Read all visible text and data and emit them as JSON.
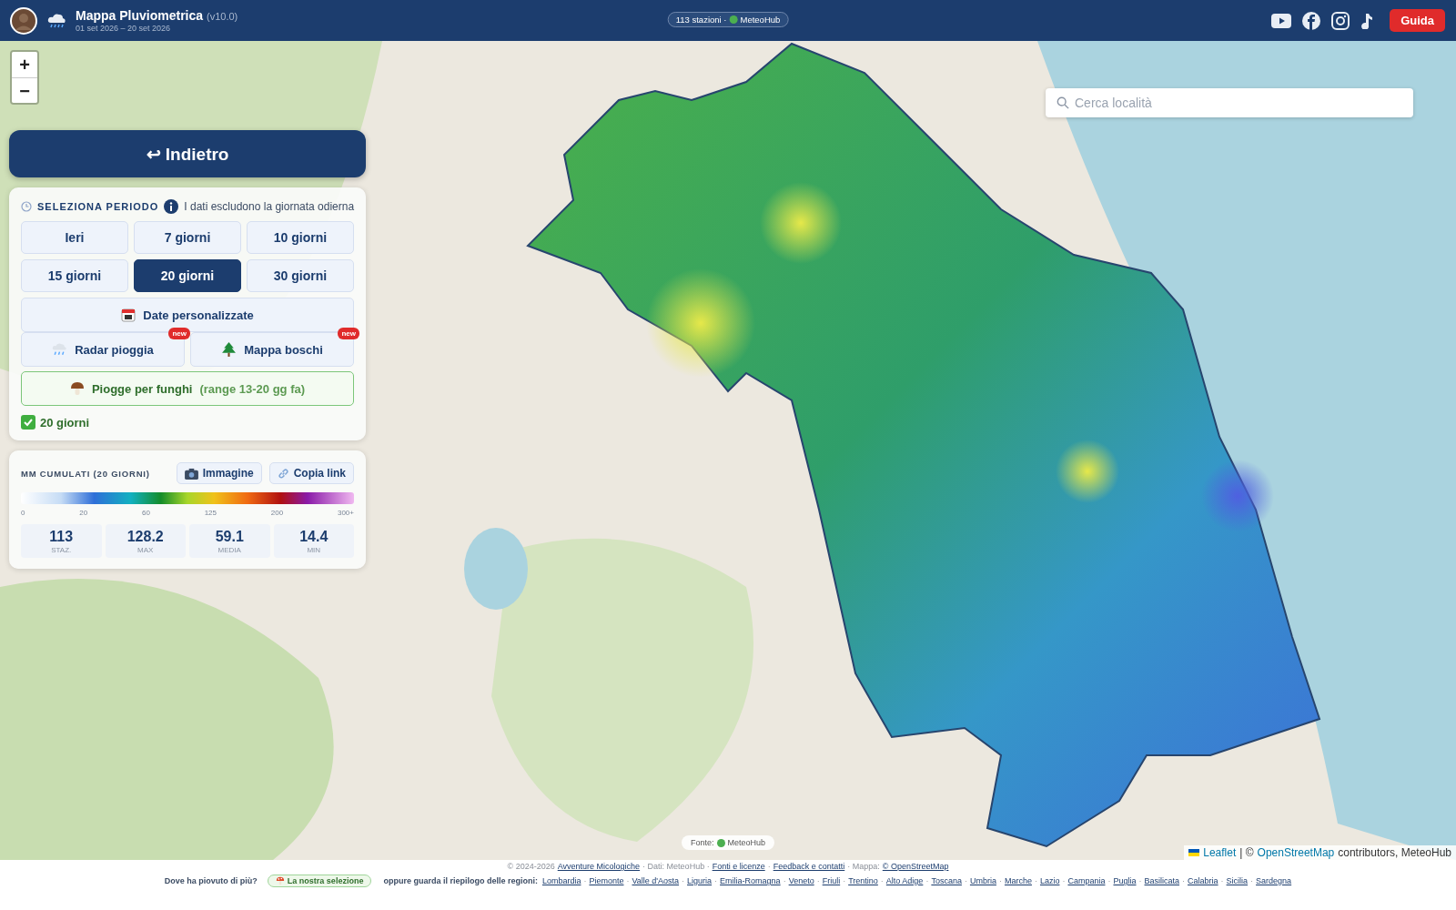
{
  "header": {
    "title": "Mappa Pluviometrica",
    "version": "(v10.0)",
    "dates": "01 set 2026 – 20 set 2026",
    "badge": {
      "stations": "113 stazioni ·",
      "source": "MeteoHub",
      "color": "#4caf50"
    },
    "guide_button": "Guida"
  },
  "map": {
    "zoom_in": "+",
    "zoom_out": "−",
    "search": {
      "placeholder": "Cerca località"
    },
    "source_badge": {
      "label": "Fonte:",
      "source": "MeteoHub",
      "color": "#4caf50"
    },
    "attribution": {
      "leaflet": "Leaflet",
      "separator": "| ©",
      "osm": "OpenStreetMap",
      "rest": "contributors, MeteoHub"
    }
  },
  "panel": {
    "back_button": "↩ Indietro",
    "period": {
      "title": "SELEZIONA PERIODO",
      "note": "I dati escludono la giornata odierna",
      "options": [
        {
          "label": "Ieri",
          "selected": false
        },
        {
          "label": "7 giorni",
          "selected": false
        },
        {
          "label": "10 giorni",
          "selected": false
        },
        {
          "label": "15 giorni",
          "selected": false
        },
        {
          "label": "20 giorni",
          "selected": true
        },
        {
          "label": "30 giorni",
          "selected": false
        }
      ],
      "custom_dates": "Date personalizzate",
      "extras": [
        {
          "label": "Radar pioggia",
          "kind": "radar",
          "badge": "new"
        },
        {
          "label": "Mappa boschi",
          "kind": "forest",
          "badge": "new"
        }
      ],
      "mushroom_button": {
        "label": "Piogge per funghi",
        "detail": "(range 13-20 gg fa)"
      },
      "current": "20 giorni"
    },
    "legend": {
      "title": "MM CUMULATI (20 GIORNI)",
      "image_button": "Immagine",
      "copy_button": "Copia link",
      "ticks": [
        "0",
        "20",
        "60",
        "125",
        "200",
        "300+"
      ],
      "stats": [
        {
          "value": "113",
          "label": "STAZ."
        },
        {
          "value": "128.2",
          "label": "MAX"
        },
        {
          "value": "59.1",
          "label": "MEDIA"
        },
        {
          "value": "14.4",
          "label": "MIN"
        }
      ]
    }
  },
  "footer": {
    "copyright": "© 2024-2026",
    "site_link": "Avventure Micologiche",
    "data_note": "· Dati: MeteoHub ·",
    "links": [
      "Fonti e licenze",
      "Feedback e contatti"
    ],
    "map_note": "· Mappa:",
    "osm_link": "© OpenStreetMap",
    "separator": "·",
    "question": "Dove ha piovuto di più?",
    "selection_button": "La nostra selezione",
    "regions_intro": "oppure guarda il riepilogo delle regioni:",
    "regions": [
      "Lombardia",
      "Piemonte",
      "Valle d'Aosta",
      "Liguria",
      "Emilia-Romagna",
      "Veneto",
      "Friuli",
      "Trentino",
      "Alto Adige",
      "Toscana",
      "Umbria",
      "Marche",
      "Lazio",
      "Campania",
      "Puglia",
      "Basilicata",
      "Calabria",
      "Sicilia",
      "Sardegna"
    ]
  }
}
